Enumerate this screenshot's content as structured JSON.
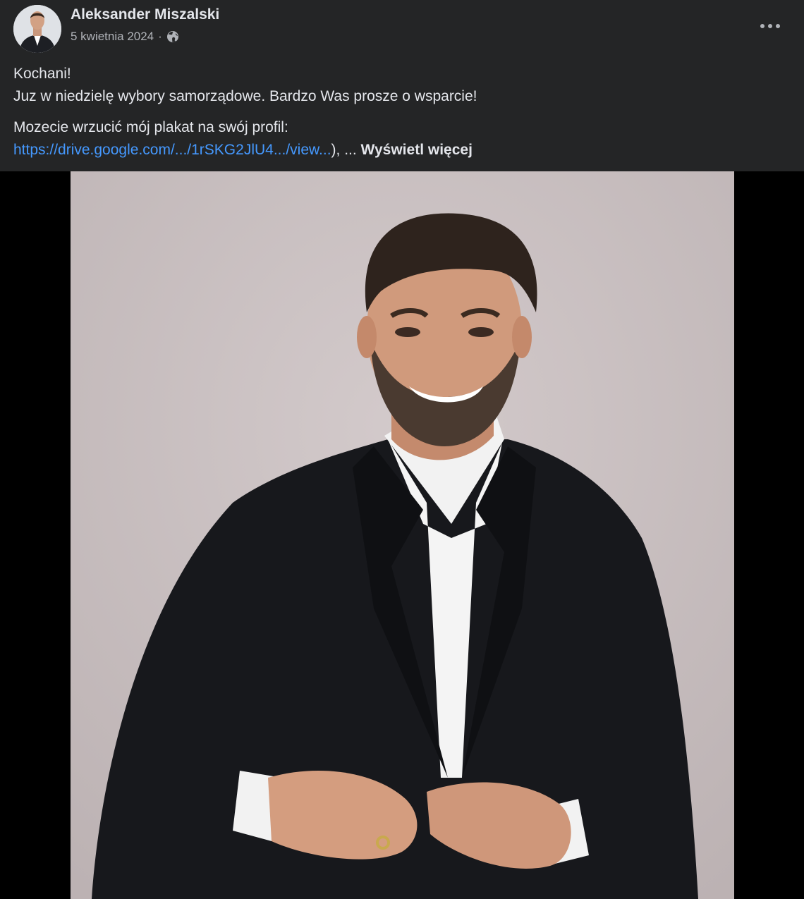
{
  "post": {
    "author": "Aleksander Miszalski",
    "date": "5 kwietnia 2024",
    "separator": "·",
    "audience_icon": "globe-icon",
    "more_icon": "more-options-icon",
    "paragraph1_line1": "Kochani!",
    "paragraph1_line2": "Juz w niedzielę wybory samorządowe. Bardzo Was prosze o wsparcie!",
    "paragraph2_line1": "Mozecie wrzucić mój plakat na swój profil:",
    "link_text": "https://drive.google.com/.../1rSKG2JlU4.../view...",
    "link_suffix": "), ...",
    "see_more": "Wyświetl więcej"
  },
  "colors": {
    "background": "#242526",
    "text": "#e4e6eb",
    "secondary_text": "#b0b3b8",
    "link": "#4599ff",
    "photo_backdrop": "#c8bfc0"
  }
}
